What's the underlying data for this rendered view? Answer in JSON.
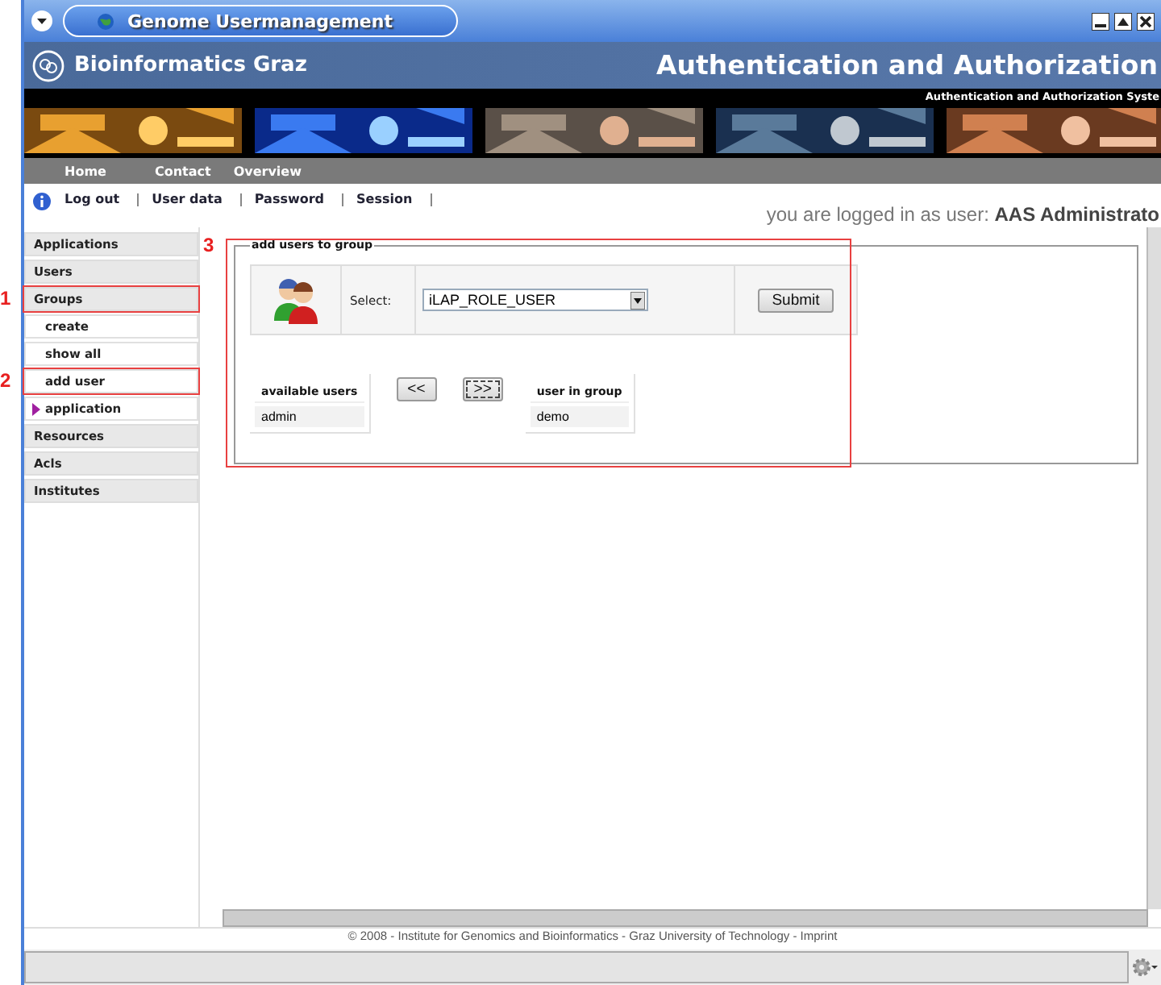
{
  "window": {
    "title": "Genome Usermanagement"
  },
  "header": {
    "brand": "Bioinformatics Graz",
    "title": "Authentication and Authorization",
    "subtitle": "Authentication and Authorization Syste"
  },
  "nav": [
    "Home",
    "Contact",
    "Overview"
  ],
  "user_links": [
    "Log out",
    "User data",
    "Password",
    "Session"
  ],
  "login_status": "you are logged in as user: **AAS Administrato**",
  "sidebar": [
    {
      "label": "Applications",
      "kind": "section",
      "expandable": false
    },
    {
      "label": "Users",
      "kind": "section",
      "expandable": false
    },
    {
      "label": "Groups",
      "kind": "section",
      "expandable": false,
      "annotation": "1"
    },
    {
      "label": "create",
      "kind": "sub",
      "expandable": false
    },
    {
      "label": "show all",
      "kind": "sub",
      "expandable": false
    },
    {
      "label": "add user",
      "kind": "sub",
      "expandable": false,
      "annotation": "2"
    },
    {
      "label": "application",
      "kind": "sub",
      "expandable": true
    },
    {
      "label": "Resources",
      "kind": "section",
      "expandable": false
    },
    {
      "label": "Acls",
      "kind": "section",
      "expandable": false
    },
    {
      "label": "Institutes",
      "kind": "section",
      "expandable": false
    }
  ],
  "panel": {
    "annotation": "3",
    "legend": "add users to group",
    "select_label": "Select:",
    "select_value": "iLAP_ROLE_USER",
    "submit": "Submit",
    "available": {
      "heading": "available users",
      "rows": [
        "admin"
      ]
    },
    "move_left": "<<",
    "move_right": ">>",
    "in_group": {
      "heading": "user in group",
      "rows": [
        "demo"
      ]
    }
  },
  "footer": "© 2008 - Institute for Genomics and Bioinformatics - Graz University of Technology - Imprint"
}
